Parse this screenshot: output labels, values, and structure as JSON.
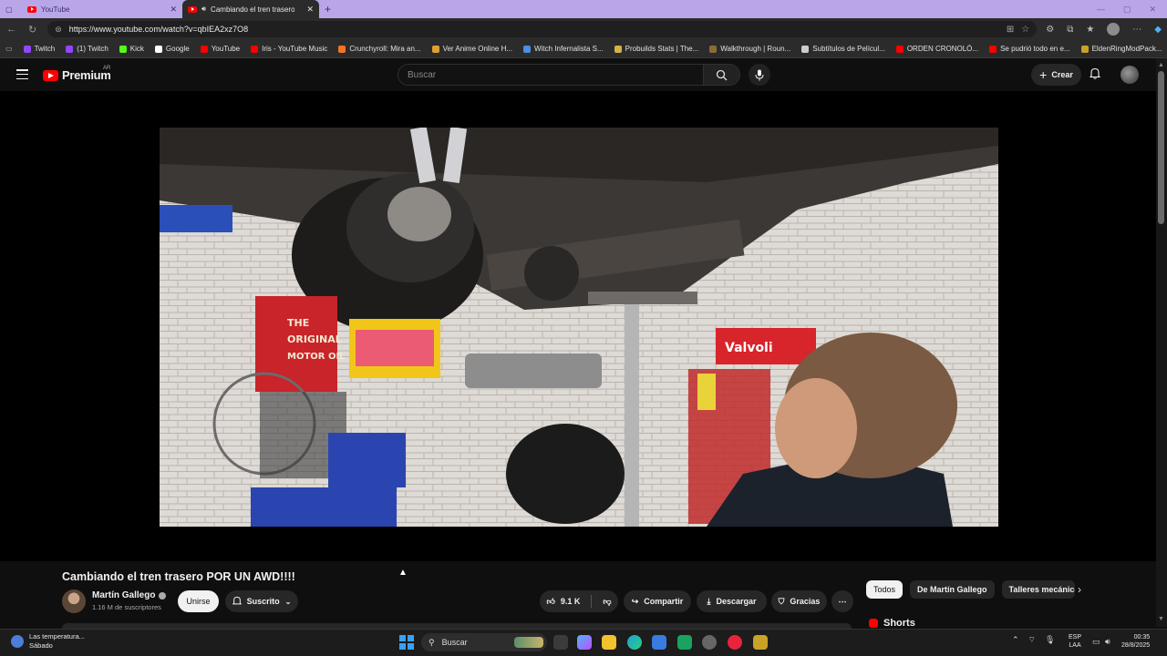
{
  "browser": {
    "tabs": [
      {
        "title": "YouTube",
        "active": false
      },
      {
        "title": "Cambiando el tren trasero P",
        "active": true
      }
    ],
    "url": "https://www.youtube.com/watch?v=qbIEA2xz7O8",
    "bookmarks": [
      {
        "label": "Twitch",
        "color": "#9146ff"
      },
      {
        "label": "(1) Twitch",
        "color": "#9146ff"
      },
      {
        "label": "Kick",
        "color": "#53fc18"
      },
      {
        "label": "Google",
        "color": "#ffffff"
      },
      {
        "label": "YouTube",
        "color": "#ff0000"
      },
      {
        "label": "Iris - YouTube Music",
        "color": "#ff0000"
      },
      {
        "label": "Crunchyroll: Mira an...",
        "color": "#f47521"
      },
      {
        "label": "Ver Anime Online H...",
        "color": "#e0a030"
      },
      {
        "label": "Witch Infernalista S...",
        "color": "#4a90e2"
      },
      {
        "label": "Probuilds Stats | The...",
        "color": "#d4b24a"
      },
      {
        "label": "Walkthrough | Roun...",
        "color": "#8b6b3a"
      },
      {
        "label": "Subtítulos de Películ...",
        "color": "#cccccc"
      },
      {
        "label": "ORDEN CRONOLÓ...",
        "color": "#ff0000"
      },
      {
        "label": "Se pudrió todo en e...",
        "color": "#ff0000"
      },
      {
        "label": "EldenRingModPack...",
        "color": "#c9a227"
      }
    ]
  },
  "youtube": {
    "logo_text": "Premium",
    "logo_region": "AR",
    "search_placeholder": "Buscar",
    "create_label": "Crear",
    "video": {
      "title": "Cambiando el tren trasero POR UN AWD!!!!",
      "channel": "Martín Gallego",
      "subscribers": "1.16 M de suscriptores",
      "join_label": "Unirse",
      "subscribed_label": "Suscrito",
      "likes": "9.1 K",
      "share_label": "Compartir",
      "download_label": "Descargar",
      "thanks_label": "Gracias"
    },
    "chips": [
      "Todos",
      "De Martín Gallego",
      "Talleres mecánicos"
    ],
    "shorts_label": "Shorts"
  },
  "taskbar": {
    "weather_line1": "Las temperatura...",
    "weather_line2": "Sábado",
    "search_label": "Buscar",
    "lang_line1": "ESP",
    "lang_line2": "LAA",
    "time": "00:35",
    "date": "28/8/2025"
  },
  "colors": {
    "youtube_red": "#ff0000",
    "background": "#0f0f0f",
    "tabbar": "#b9a6e8"
  }
}
